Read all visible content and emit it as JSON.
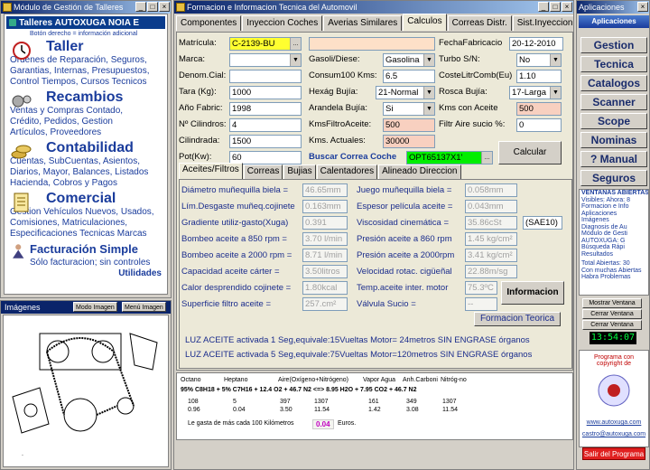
{
  "left": {
    "title": "Módulo de Gestión de Talleres",
    "header": "Talleres AUTOXUGA NOIA E",
    "hint": "Botón derecho = información adicional",
    "taller": {
      "h": "Taller",
      "l1": "Ordenes de Reparación, Seguros,",
      "l2": "Garantias, Internas, Presupuestos,",
      "l3": "Control Tiempos, Cursos Tecnicos"
    },
    "recambios": {
      "h": "Recambios",
      "l1": "Ventas y Compras Contado,",
      "l2": "Crédito, Pedidos, Gestion",
      "l3": "Artículos, Proveedores"
    },
    "contab": {
      "h": "Contabilidad",
      "l1": "Cuentas, SubCuentas, Asientos,",
      "l2": "Diarios, Mayor, Balances, Listados",
      "l3": "Hacienda, Cobros y Pagos"
    },
    "comercial": {
      "h": "Comercial",
      "l1": "Gestion Vehículos Nuevos, Usados,",
      "l2": "Comisiones, Matriculaciones,",
      "l3": "Especificaciones Tecnicas Marcas"
    },
    "fact": {
      "h": "Facturación Simple",
      "l1": "Sólo facturacion; sin controles"
    },
    "util": "Utilidades"
  },
  "images": {
    "title": "Imágenes",
    "b1": "Modo Imagen",
    "b2": "Menú Imagen"
  },
  "main": {
    "title": "Formacion e Informacion Tecnica del Automovil",
    "tabs": [
      "Componentes",
      "Inyeccion Coches",
      "Averias Similares",
      "Calculos",
      "Correas Distr.",
      "Sist.Inyeccion"
    ],
    "f": {
      "matricula_l": "Matrícula:",
      "matricula": "C-2139-BU",
      "marca_l": "Marca:",
      "denom_l": "Denom.Cial:",
      "tara_l": "Tara (Kg):",
      "tara": "1000",
      "anio_l": "Año Fabric:",
      "anio": "1998",
      "cil_l": "Nº Cilindros:",
      "cil": "4",
      "cilindrada_l": "Cilindrada:",
      "cilindrada": "1500",
      "pot_l": "Pot(Kw):",
      "pot": "60",
      "gas_l": "Gasoli/Diese:",
      "gas": "Gasolina",
      "cons_l": "Consum100 Kms:",
      "cons": "6.5",
      "hex_l": "Hexág Bujía:",
      "hex": "21-Normal",
      "aran_l": "Arandela Bujía:",
      "aran": "Si",
      "kmsf_l": "KmsFiltroAceite:",
      "kmsf": "500",
      "kmsa_l": "Kms. Actuales:",
      "kmsa": "30000",
      "buscar": "Buscar Correa Coche",
      "correa": "OPT65137X1'",
      "fecha_l": "FechaFabricacio",
      "fecha": "20-12-2010",
      "turbo_l": "Turbo S/N:",
      "turbo": "No",
      "coste_l": "CosteLitrComb(Eu)",
      "coste": "1.10",
      "rosca_l": "Rosca Bujía:",
      "rosca": "17-Larga",
      "kmsac_l": "Kms con Aceite",
      "kmsac": "500",
      "filtro_l": "Filtr Aire sucio %:",
      "filtro": "0",
      "calcular": "Calcular"
    },
    "stabs": [
      "Aceites/Filtros",
      "Correas",
      "Bujias",
      "Calentadores",
      "Alineado Direccion"
    ],
    "s": {
      "a1": "Diámetro muñequilla biela =",
      "v1": "46.65mm",
      "a2": "Lím.Desgaste muñeq.cojinete",
      "v2": "0.163mm",
      "a3": "Gradiente utiliz-gasto(Xuga)",
      "v3": "0.391",
      "a4": "Bombeo aceite a 850 rpm =",
      "v4": "3.70 l/min",
      "a5": "Bombeo aceite a 2000 rpm =",
      "v5": "8.71 l/min",
      "a6": "Capacidad aceite cárter =",
      "v6": "3.50litros",
      "a7": "Calor desprendido cojinete =",
      "v7": "1.80kcal",
      "a8": "Superficie filtro aceite =",
      "v8": "257.cm²",
      "b1": "Juego muñequilla biela =",
      "w1": "0.058mm",
      "b2": "Espesor película aceite =",
      "w2": "0.043mm",
      "b3": "Viscosidad cinemática =",
      "w3": "35.86cSt",
      "sae": "(SAE10)",
      "b4": "Presión aceite a 860 rpm",
      "w4": "1.45 kg/cm²",
      "b5": "Presión aceite a 2000rpm",
      "w5": "3.41 kg/cm²",
      "b6": "Velocidad rotac. cigüeñal",
      "w6": "22.88m/sg",
      "b7": "Temp.aceite inter. motor",
      "w7": "75.3ºC",
      "b8": "Válvula Sucio =",
      "w8": "--",
      "info": "Informacion",
      "formacion": "Formacion Teorica",
      "luz1": "LUZ ACEITE activada 1 Seg,equivale:15Vueltas Motor= 24metros SIN ENGRASE órganos",
      "luz2": "LUZ ACEITE activada 5 Seg,equivale:75Vueltas Motor=120metros SIN ENGRASE órganos"
    },
    "chem": {
      "h1": "Octano",
      "h2": "Heptano",
      "h3": "Aire(Oxígeno+Nitrógeno)",
      "h4": "Vapor Agua",
      "h5": "Anh.Carboni",
      "h6": "Nitróg-no",
      "eq": "95% C8H18  +  5% C7H16  +  12.4 O2  +  46.7 N2   <=>   8.95 H2O  +  7.95 CO2  +  46.7 N2",
      "r1": [
        "108",
        "5",
        "397",
        "1307",
        "161",
        "349",
        "1307"
      ],
      "r2": [
        "0.96",
        "0.04",
        "3.50",
        "11.54",
        "1.42",
        "3.08",
        "11.54"
      ],
      "gasto_l": "Le gasta de más cada 100 Kilómetros",
      "gasto": "0.04",
      "euros": "Euros."
    }
  },
  "right": {
    "title": "Aplicaciones",
    "sub": "Aplicaciones",
    "buttons": [
      "Gestion",
      "Tecnica",
      "Catalogos",
      "Scanner",
      "Scope",
      "Nominas",
      "? Manual",
      "Seguros"
    ],
    "list": [
      "VENTANAS ABIERTAS",
      "Visibles: Ahora: 8",
      "Formacion e Info",
      "Aplicaciones",
      "Imágenes",
      "Diagnosis de Au",
      "Módulo de Gesti",
      "AUTOXUGA: G",
      "Búsqueda Rápi",
      "Resultados",
      "Total Abiertas: 30",
      "Con muchas Abiertas",
      "Habra Problemas"
    ],
    "b1": "Mostrar Ventana",
    "b2": "Cerrar Ventana",
    "b3": "Cerrar Ventana",
    "clock": "13:54:07",
    "p1": "Programa con",
    "p2": "copyright de",
    "web": "www.autoxuga.com",
    "mail": "castro@autoxuga.com",
    "exit": "Salir del Programa"
  }
}
